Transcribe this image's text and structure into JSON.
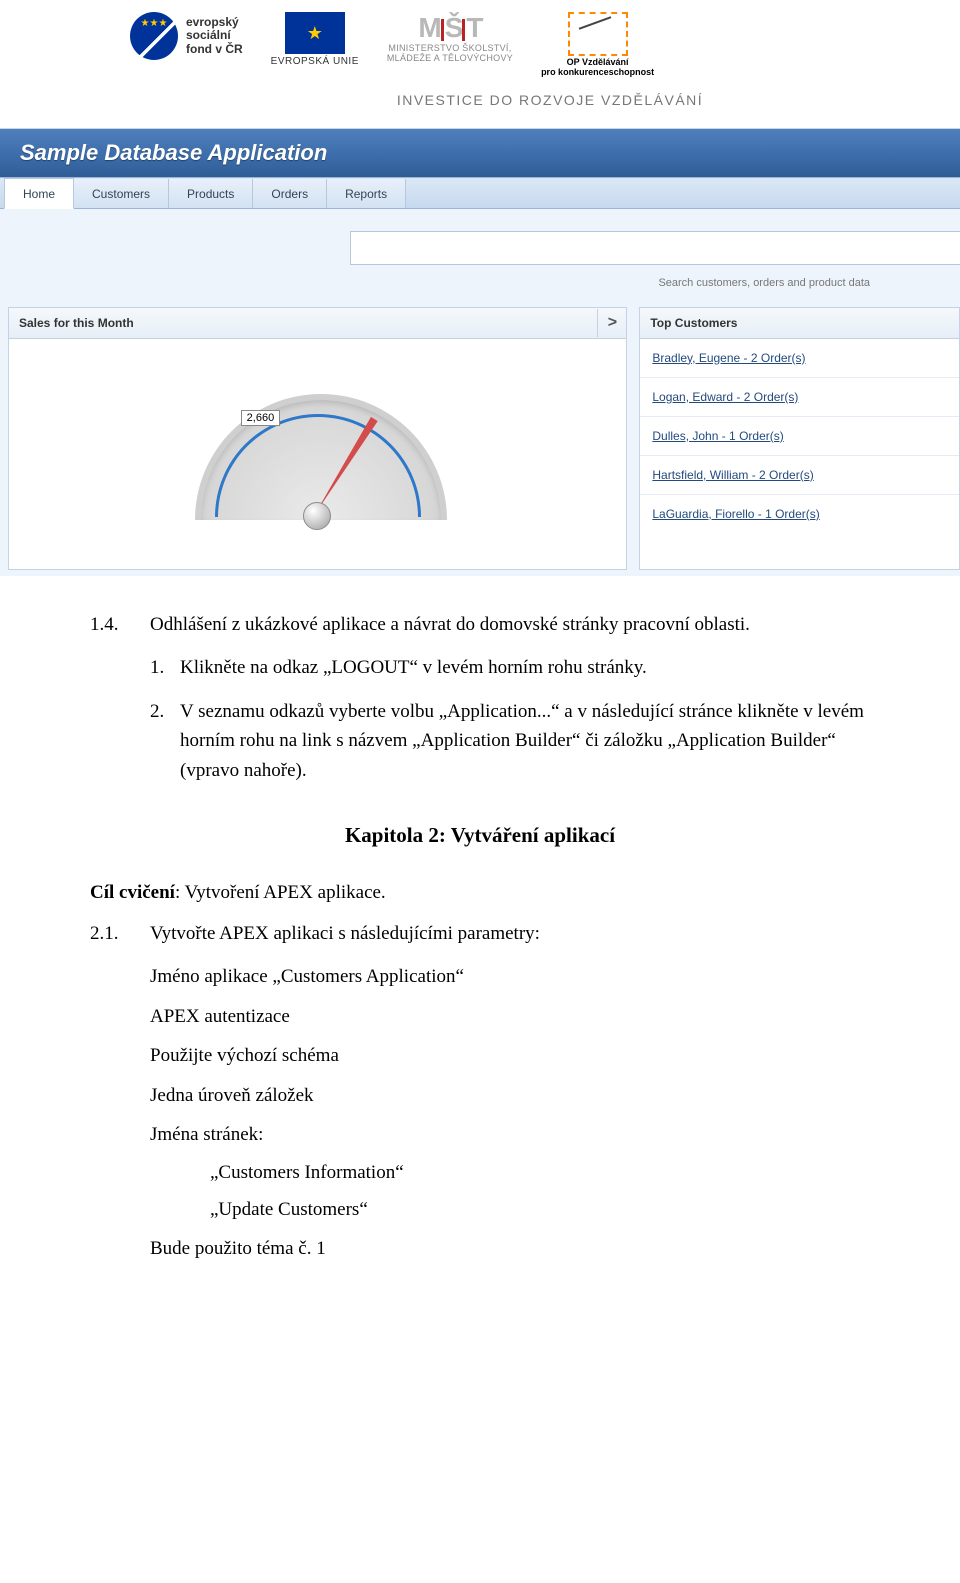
{
  "header": {
    "esf_line1": "evropský",
    "esf_line2": "sociální",
    "esf_line3": "fond v ČR",
    "eu_label": "EVROPSKÁ UNIE",
    "msmt_line1": "MINISTERSTVO ŠKOLSTVÍ,",
    "msmt_line2": "MLÁDEŽE A TĚLOVÝCHOVY",
    "op_line1": "OP Vzdělávání",
    "op_line2": "pro konkurenceschopnost",
    "invest": "INVESTICE DO ROZVOJE VZDĚLÁVÁNÍ"
  },
  "app": {
    "title": "Sample Database Application",
    "tabs": [
      "Home",
      "Customers",
      "Products",
      "Orders",
      "Reports"
    ],
    "search_placeholder": "",
    "search_hint": "Search customers, orders and product data",
    "sales_panel_title": "Sales for this Month",
    "collapse_glyph": ">",
    "top_customers_title": "Top Customers",
    "customers": [
      "Bradley, Eugene - 2 Order(s)",
      "Logan, Edward - 2 Order(s)",
      "Dulles, John - 1 Order(s)",
      "Hartsfield, William - 2 Order(s)",
      "LaGuardia, Fiorello - 1 Order(s)"
    ]
  },
  "chart_data": {
    "type": "gauge",
    "title": "Sales for this Month",
    "value": 2660,
    "value_label": "2,660",
    "range": [
      0,
      10000
    ]
  },
  "doc": {
    "s14_num": "1.4.",
    "s14_text": "Odhlášení z ukázkové aplikace a návrat do domovské stránky pracovní oblasti.",
    "s14_step1_num": "1.",
    "s14_step1": "Klikněte na odkaz „LOGOUT“ v levém horním rohu stránky.",
    "s14_step2_num": "2.",
    "s14_step2": "V seznamu odkazů vyberte volbu „Application...“ a v následující stránce klikněte v levém horním rohu na link s názvem „Application Builder“ či záložku „Application Builder“ (vpravo nahoře).",
    "chapter_title": "Kapitola 2: Vytváření aplikací",
    "goal_label": "Cíl cvičení",
    "goal_text": ": Vytvoření APEX aplikace.",
    "s21_num": "2.1.",
    "s21_text": "Vytvořte APEX aplikaci s následujícími parametry:",
    "p_name": "Jméno aplikace „Customers Application“",
    "p_auth": "APEX autentizace",
    "p_schema": "Použijte výchozí schéma",
    "p_tabs": "Jedna úroveň záložek",
    "p_pages_label": "Jména stránek:",
    "p_page1": "„Customers Information“",
    "p_page2": "„Update Customers“",
    "p_theme": "Bude použito téma č. 1"
  }
}
